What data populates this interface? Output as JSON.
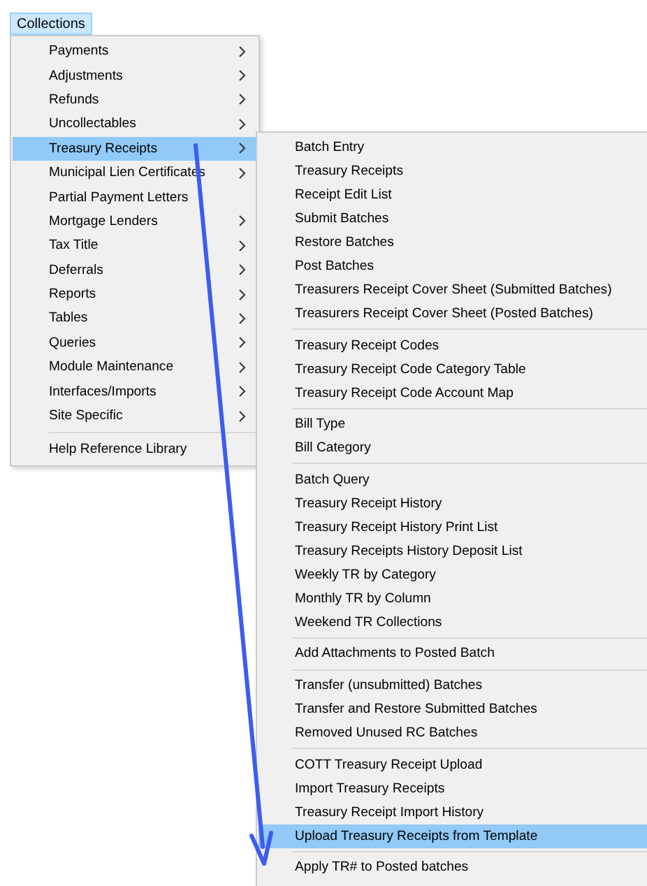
{
  "menubar": [
    {
      "label": "Collections",
      "selected": true
    }
  ],
  "main_menu": {
    "groups": [
      {
        "items": [
          {
            "label": "Payments",
            "has_submenu": true,
            "selected": false
          },
          {
            "label": "Adjustments",
            "has_submenu": true,
            "selected": false
          },
          {
            "label": "Refunds",
            "has_submenu": true,
            "selected": false
          },
          {
            "label": "Uncollectables",
            "has_submenu": true,
            "selected": false
          },
          {
            "label": "Treasury Receipts",
            "has_submenu": true,
            "selected": true
          },
          {
            "label": "Municipal Lien Certificates",
            "has_submenu": true,
            "selected": false
          },
          {
            "label": "Partial Payment Letters",
            "has_submenu": false,
            "selected": false
          },
          {
            "label": "Mortgage Lenders",
            "has_submenu": true,
            "selected": false
          },
          {
            "label": "Tax Title",
            "has_submenu": true,
            "selected": false
          },
          {
            "label": "Deferrals",
            "has_submenu": true,
            "selected": false
          },
          {
            "label": "Reports",
            "has_submenu": true,
            "selected": false
          },
          {
            "label": "Tables",
            "has_submenu": true,
            "selected": false
          },
          {
            "label": "Queries",
            "has_submenu": true,
            "selected": false
          },
          {
            "label": "Module Maintenance",
            "has_submenu": true,
            "selected": false
          },
          {
            "label": "Interfaces/Imports",
            "has_submenu": true,
            "selected": false
          },
          {
            "label": "Site Specific",
            "has_submenu": true,
            "selected": false
          }
        ]
      },
      {
        "items": [
          {
            "label": "Help Reference Library",
            "has_submenu": false,
            "selected": false
          }
        ]
      }
    ]
  },
  "submenu": {
    "groups": [
      {
        "items": [
          {
            "label": "Batch Entry",
            "selected": false
          },
          {
            "label": "Treasury Receipts",
            "selected": false
          },
          {
            "label": "Receipt Edit List",
            "selected": false
          },
          {
            "label": "Submit Batches",
            "selected": false
          },
          {
            "label": "Restore Batches",
            "selected": false
          },
          {
            "label": "Post Batches",
            "selected": false
          },
          {
            "label": "Treasurers Receipt Cover Sheet (Submitted Batches)",
            "selected": false
          },
          {
            "label": "Treasurers Receipt Cover Sheet (Posted Batches)",
            "selected": false
          }
        ]
      },
      {
        "items": [
          {
            "label": "Treasury Receipt Codes",
            "selected": false
          },
          {
            "label": "Treasury Receipt Code Category Table",
            "selected": false
          },
          {
            "label": "Treasury Receipt Code Account Map",
            "selected": false
          }
        ]
      },
      {
        "items": [
          {
            "label": "Bill Type",
            "selected": false
          },
          {
            "label": "Bill Category",
            "selected": false
          }
        ]
      },
      {
        "items": [
          {
            "label": "Batch Query",
            "selected": false
          },
          {
            "label": "Treasury Receipt History",
            "selected": false
          },
          {
            "label": "Treasury Receipt History Print List",
            "selected": false
          },
          {
            "label": "Treasury Receipts History Deposit List",
            "selected": false
          },
          {
            "label": "Weekly TR by Category",
            "selected": false
          },
          {
            "label": "Monthly TR by Column",
            "selected": false
          },
          {
            "label": "Weekend TR Collections",
            "selected": false
          }
        ]
      },
      {
        "items": [
          {
            "label": "Add Attachments to Posted Batch",
            "selected": false
          }
        ]
      },
      {
        "items": [
          {
            "label": "Transfer (unsubmitted) Batches",
            "selected": false
          },
          {
            "label": "Transfer and Restore Submitted Batches",
            "selected": false
          },
          {
            "label": "Removed Unused RC Batches",
            "selected": false
          }
        ]
      },
      {
        "items": [
          {
            "label": "COTT Treasury Receipt Upload",
            "selected": false
          },
          {
            "label": "Import Treasury Receipts",
            "selected": false
          },
          {
            "label": "Treasury Receipt Import History",
            "selected": false
          },
          {
            "label": "Upload Treasury Receipts from Template",
            "selected": true
          }
        ]
      },
      {
        "items": [
          {
            "label": "Apply TR# to Posted batches",
            "selected": false
          }
        ]
      }
    ]
  }
}
